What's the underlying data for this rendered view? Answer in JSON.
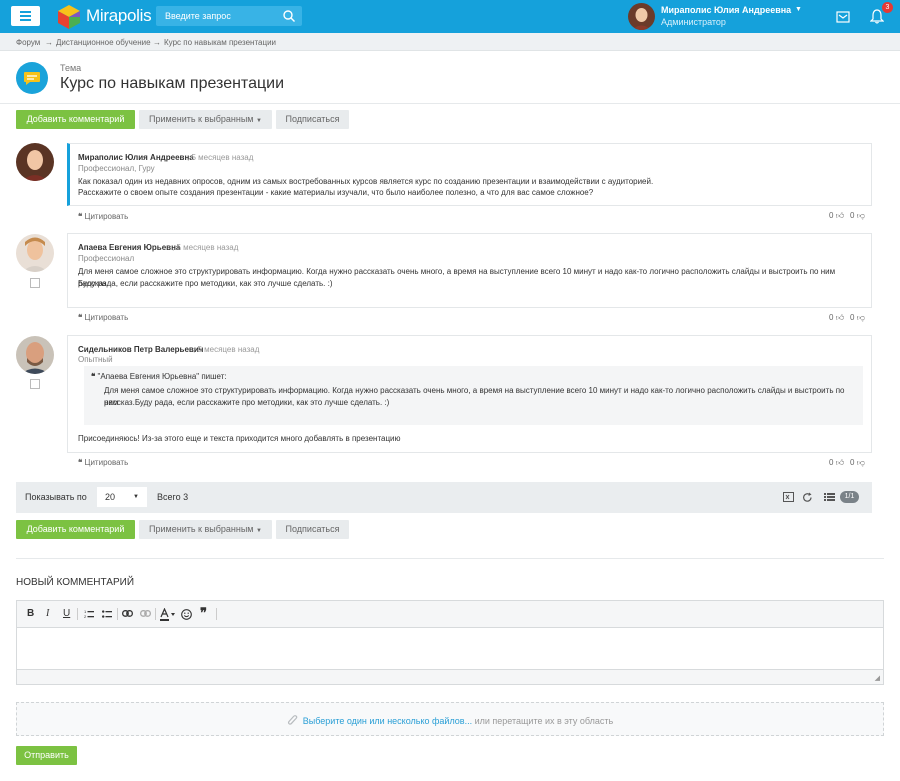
{
  "app": {
    "name": "Mirapolis",
    "notifications": "3"
  },
  "search": {
    "placeholder": "Введите запрос"
  },
  "user": {
    "name": "Мираполис Юлия Андреевна",
    "role": "Администратор"
  },
  "breadcrumb": [
    "Форум",
    "Дистанционное обучение",
    "Курс по навыкам презентации"
  ],
  "breadcrumb_sep": "→",
  "header": {
    "label": "Тема",
    "title": "Курс по навыкам презентации"
  },
  "actions": {
    "add_comment": "Добавить комментарий",
    "apply_selected": "Применить к выбранным",
    "subscribe": "Подписаться"
  },
  "comments": [
    {
      "author": "Мираполис Юлия Андреевна",
      "ago": ", 5 месяцев назад",
      "role": "Профессионал, Гуру",
      "lines": [
        "Как показал один из недавних опросов, одним из самых востребованных курсов является курс по созданию презентации и взаимодействии с аудиторией.",
        "Расскажите о своем опыте создания презентации - какие материалы изучали, что было наиболее полезно, а что для вас самое сложное?"
      ],
      "cite": "Цитировать",
      "likes": "0",
      "dislikes": "0"
    },
    {
      "author": "Апаева Евгения Юрьевна",
      "ago": ", 5 месяцев назад",
      "role": "Профессионал",
      "lines": [
        "Для меня самое сложное это структурировать информацию. Когда нужно рассказать очень много, а время на выступление всего 10 минут и надо как-то логично расположить слайды и выстроить по ним рассказ.",
        "Буду рада, если расскажите про методики, как это лучше сделать. :)"
      ],
      "cite": "Цитировать",
      "likes": "0",
      "dislikes": "0"
    },
    {
      "author": "Сидельников Петр Валерьевич",
      "ago": ", 5 месяцев назад",
      "role": "Опытный",
      "quote_head": "\"Апаева Евгения Юрьевна\" пишет:",
      "quote_lines": [
        "Для меня самое сложное это структурировать информацию. Когда нужно рассказать очень много, а время на выступление всего 10 минут и надо как-то логично расположить слайды и выстроить по ним",
        "рассказ.Буду рада, если расскажите про методики, как это лучше сделать. :)"
      ],
      "text": "Присоединяюсь! Из-за этого еще и текста приходится много добавлять в презентацию",
      "cite": "Цитировать",
      "likes": "0",
      "dislikes": "0"
    }
  ],
  "pager": {
    "show_label": "Показывать по",
    "page_size": "20",
    "total": "Всего 3",
    "page": "1/1"
  },
  "new_comment": {
    "title": "НОВЫЙ КОММЕНТАРИЙ",
    "toolbar": [
      "B",
      "I",
      "U"
    ],
    "file_link": "Выберите один или несколько файлов...",
    "file_hint": " или перетащите их в эту область",
    "submit": "Отправить"
  },
  "colors": {
    "topbar": "#15a1db",
    "accent_green": "#7cc242",
    "link": "#2a9fd6"
  }
}
